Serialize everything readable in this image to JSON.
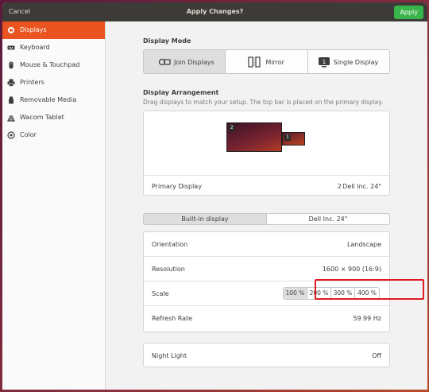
{
  "header": {
    "cancel_label": "Cancel",
    "title": "Apply Changes?",
    "apply_label": "Apply"
  },
  "sidebar": {
    "items": [
      {
        "label": "Displays",
        "icon": "displays-icon",
        "active": true
      },
      {
        "label": "Keyboard",
        "icon": "keyboard-icon"
      },
      {
        "label": "Mouse & Touchpad",
        "icon": "mouse-icon"
      },
      {
        "label": "Printers",
        "icon": "printer-icon"
      },
      {
        "label": "Removable Media",
        "icon": "removable-media-icon"
      },
      {
        "label": "Wacom Tablet",
        "icon": "wacom-tablet-icon"
      },
      {
        "label": "Color",
        "icon": "color-icon"
      }
    ]
  },
  "display_mode": {
    "title": "Display Mode",
    "options": [
      {
        "label": "Join Displays",
        "icon": "join-displays-icon",
        "active": true
      },
      {
        "label": "Mirror",
        "icon": "mirror-icon"
      },
      {
        "label": "Single Display",
        "icon": "single-display-icon"
      }
    ]
  },
  "arrangement": {
    "title": "Display Arrangement",
    "subtitle": "Drag displays to match your setup. The top bar is placed on the primary display.",
    "monitors": [
      {
        "badge": "2"
      },
      {
        "badge": "1"
      }
    ],
    "primary_label": "Primary Display",
    "primary_number": "2",
    "primary_value": "Dell Inc. 24\""
  },
  "display_tabs": [
    {
      "label": "Built-in display",
      "active": true
    },
    {
      "label": "Dell Inc. 24\""
    }
  ],
  "settings": {
    "orientation_label": "Orientation",
    "orientation_value": "Landscape",
    "resolution_label": "Resolution",
    "resolution_value": "1600 × 900 (16:9)",
    "scale_label": "Scale",
    "scale_options": [
      "100 %",
      "200 %",
      "300 %",
      "400 %"
    ],
    "scale_selected": "100 %",
    "refresh_label": "Refresh Rate",
    "refresh_value": "59.99 Hz"
  },
  "night_light": {
    "label": "Night Light",
    "value": "Off"
  },
  "colors": {
    "accent": "#e95420",
    "apply_green": "#38b44a",
    "highlight_red": "#e01b24"
  }
}
